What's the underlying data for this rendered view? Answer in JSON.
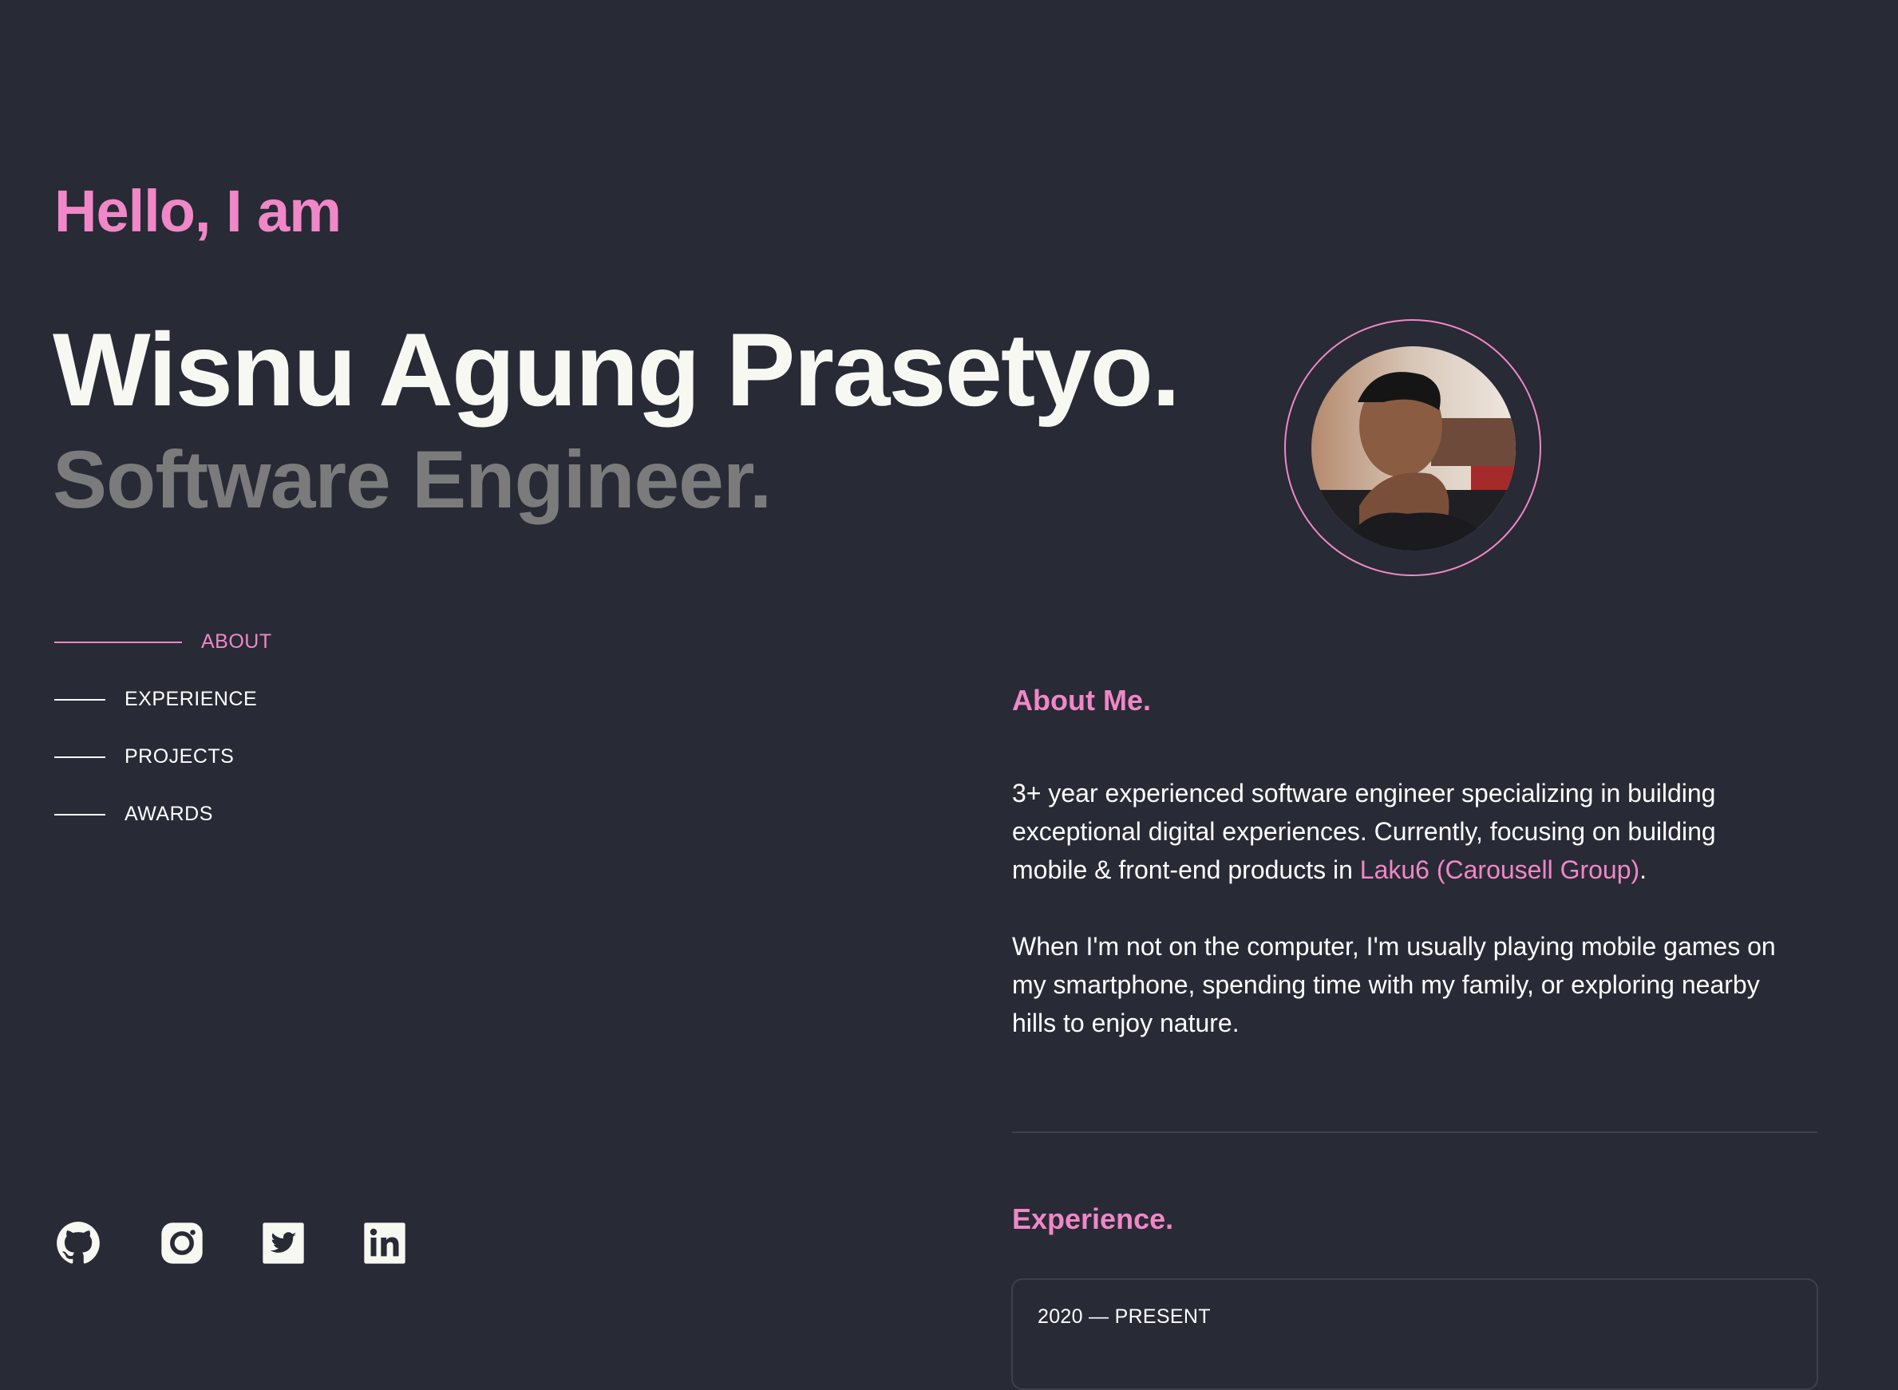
{
  "hero": {
    "greeting": "Hello, I am",
    "name": "Wisnu Agung Prasetyo.",
    "role": "Software Engineer."
  },
  "nav": {
    "items": [
      {
        "label": "ABOUT",
        "active": true
      },
      {
        "label": "EXPERIENCE",
        "active": false
      },
      {
        "label": "PROJECTS",
        "active": false
      },
      {
        "label": "AWARDS",
        "active": false
      }
    ]
  },
  "about": {
    "title": "About Me.",
    "para1_before": "3+ year experienced software engineer specializing in building exceptional digital experiences. Currently, focusing on building mobile & front-end products in ",
    "para1_link": "Laku6 (Carousell Group)",
    "para1_after": ".",
    "para2": "When I'm not on the computer, I'm usually playing mobile games on my smartphone, spending time with my family, or exploring nearby hills to enjoy nature."
  },
  "experience": {
    "title": "Experience.",
    "first_date": "2020 — PRESENT"
  },
  "social": {
    "icons": [
      "github-icon",
      "instagram-icon",
      "twitter-icon",
      "linkedin-icon"
    ]
  },
  "colors": {
    "background": "#282a36",
    "accent": "#f087c7",
    "text": "#f8f8f2",
    "muted": "#7b7b7b",
    "divider": "#3d404d"
  }
}
